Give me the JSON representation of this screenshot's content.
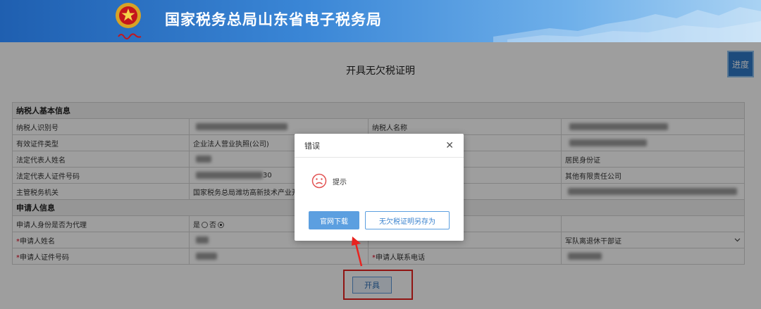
{
  "header": {
    "title": "国家税务总局山东省电子税务局",
    "emblem_icon": "tax-emblem",
    "script_text": "中国税务"
  },
  "page": {
    "title": "开具无欠税证明",
    "progress_label": "进度",
    "issue_label": "开具"
  },
  "taxpayer": {
    "section": "纳税人基本信息",
    "id_label": "纳税人识别号",
    "name_label": "纳税人名称",
    "cert_type_label": "有效证件类型",
    "cert_type_value": "企业法人营业执照(公司)",
    "legal_name_label": "法定代表人姓名",
    "legal_id_type_value": "居民身份证",
    "legal_id_label": "法定代表人证件号码",
    "legal_id_suffix": "30",
    "company_type_value": "其他有限责任公司",
    "authority_label": "主管税务机关",
    "authority_value": "国家税务总局潍坊高新技术产业开发区税务局"
  },
  "applicant": {
    "section": "申请人信息",
    "agent_label": "申请人身份是否为代理",
    "yes_label": "是",
    "no_label": "否",
    "agent_value": "否",
    "name_label": "申请人姓名",
    "id_label": "申请人证件号码",
    "phone_label": "申请人联系电话",
    "identity_value": "军队离退休干部证",
    "required_mark": "*"
  },
  "dialog": {
    "title": "错误",
    "close_icon": "close-icon",
    "face_icon": "sad-face-icon",
    "message": "提示",
    "download_label": "官网下载",
    "save_label": "无欠税证明另存为"
  },
  "colors": {
    "accent": "#2f79c9",
    "highlight": "#e8231f",
    "dialog_button": "#5c9fe0"
  }
}
